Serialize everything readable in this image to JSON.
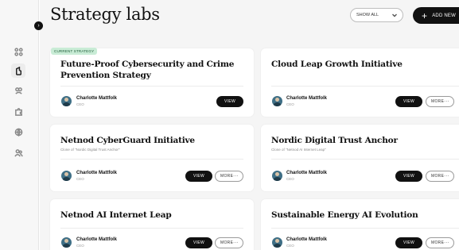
{
  "page": {
    "title": "Strategy labs"
  },
  "toolbar": {
    "filter_label": "SHOW ALL",
    "add_label": "ADD NEW"
  },
  "sidebar": {
    "items": [
      {
        "icon": "grid-icon"
      },
      {
        "icon": "strategy-icon"
      },
      {
        "icon": "lab-icon"
      },
      {
        "icon": "puzzle-icon"
      },
      {
        "icon": "globe-icon"
      },
      {
        "icon": "users-icon"
      }
    ]
  },
  "badge": {
    "label": "CURRENT STRATEGY"
  },
  "cards": [
    {
      "title": "Future-Proof Cybersecurity and Crime Prevention Strategy",
      "subtitle": "",
      "owner": "Charlotte Mattfolk",
      "role": "CEO",
      "view": "VIEW",
      "more": ""
    },
    {
      "title": "Cloud Leap Growth Initiative",
      "subtitle": "",
      "owner": "Charlotte Mattfolk",
      "role": "CEO",
      "view": "VIEW",
      "more": "MORE"
    },
    {
      "title": "Netnod CyberGuard Initiative",
      "subtitle": "Clone of \"Nordic Digital Trust Anchor\"",
      "owner": "Charlotte Mattfolk",
      "role": "CEO",
      "view": "VIEW",
      "more": "MORE"
    },
    {
      "title": "Nordic Digital Trust Anchor",
      "subtitle": "Clone of \"Netnod AI Internet Leap\"",
      "owner": "Charlotte Mattfolk",
      "role": "CEO",
      "view": "VIEW",
      "more": "MORE"
    },
    {
      "title": "Netnod AI Internet Leap",
      "subtitle": "",
      "owner": "Charlotte Mattfolk",
      "role": "CEO",
      "view": "VIEW",
      "more": "MORE"
    },
    {
      "title": "Sustainable Energy AI Evolution",
      "subtitle": "",
      "owner": "Charlotte Mattfolk",
      "role": "CEO",
      "view": "VIEW",
      "more": "MORE"
    }
  ],
  "colors": {
    "accent": "#111111",
    "badge_bg": "#c9ecd6",
    "badge_text": "#1e5b38",
    "page_bg": "#f5f5f5"
  }
}
